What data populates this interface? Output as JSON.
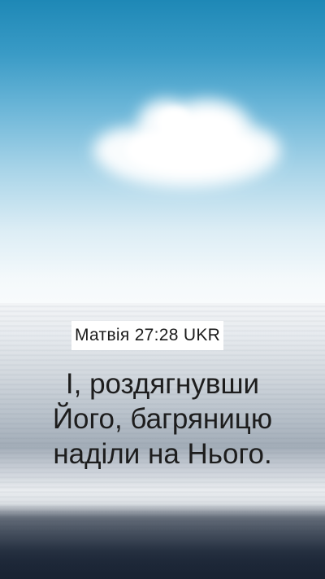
{
  "reference": "Матвія 27:28 UKR",
  "verse_lines": [
    "І, роздягнувши",
    "Його, багряницю",
    "наділи на Нього."
  ],
  "colors": {
    "sky_top": "#1e88b6",
    "sea_bottom": "#1e2837",
    "text": "#1d1d1d",
    "ref_box": "#ffffff"
  }
}
